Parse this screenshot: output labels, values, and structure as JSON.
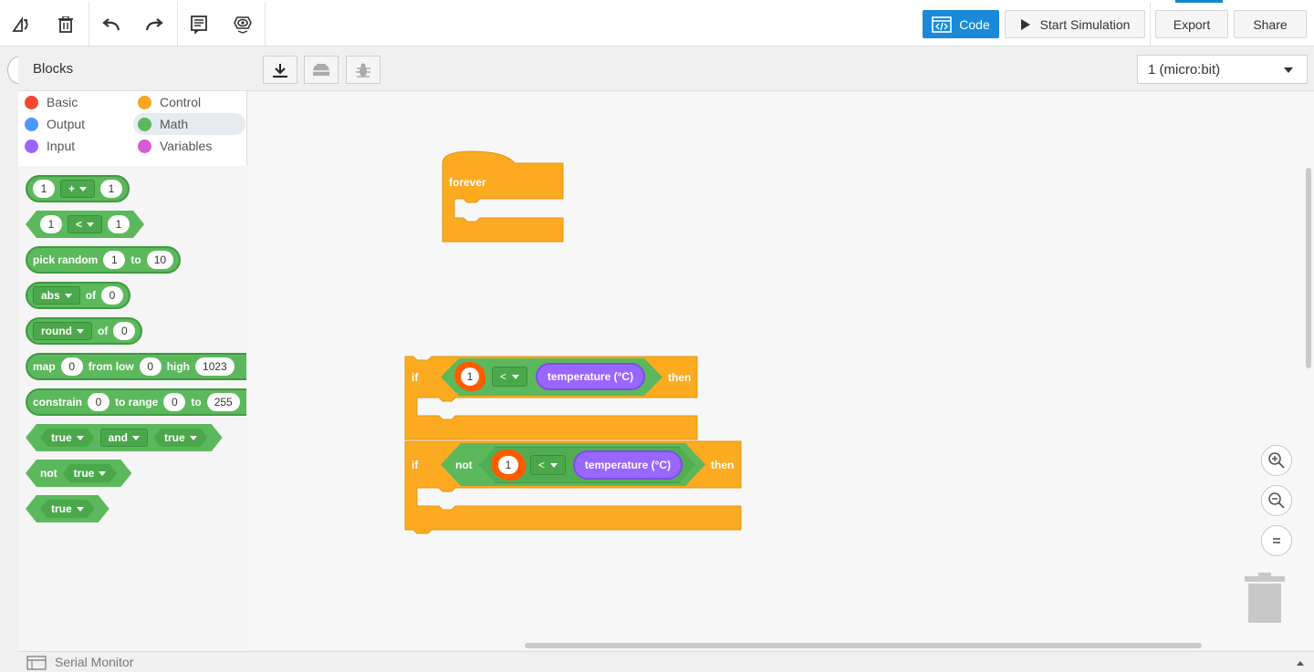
{
  "toolbar": {
    "code_label": "Code",
    "start_sim_label": "Start Simulation",
    "export_label": "Export",
    "share_label": "Share"
  },
  "blocks_panel": {
    "title": "Blocks",
    "categories": [
      {
        "label": "Basic",
        "color": "#f4492e"
      },
      {
        "label": "Control",
        "color": "#f6a51f"
      },
      {
        "label": "Output",
        "color": "#4c97ff"
      },
      {
        "label": "Math",
        "color": "#5cb85c"
      },
      {
        "label": "Input",
        "color": "#9966ff"
      },
      {
        "label": "Variables",
        "color": "#d65cd6"
      }
    ],
    "selected_category": "Math",
    "palette": {
      "add": {
        "a": "1",
        "op": "+",
        "b": "1"
      },
      "compare": {
        "a": "1",
        "op": "<",
        "b": "1"
      },
      "random": {
        "label": "pick random",
        "from": "1",
        "to_label": "to",
        "to": "10"
      },
      "abs": {
        "fn": "abs",
        "of_label": "of",
        "val": "0"
      },
      "round": {
        "fn": "round",
        "of_label": "of",
        "val": "0"
      },
      "map": {
        "label": "map",
        "val": "0",
        "from_low_label": "from low",
        "from_low": "0",
        "high_label": "high",
        "high": "1023"
      },
      "constrain": {
        "label": "constrain",
        "val": "0",
        "to_range_label": "to range",
        "low": "0",
        "to_label": "to",
        "high": "255"
      },
      "and": {
        "a": "true",
        "op": "and",
        "b": "true"
      },
      "not": {
        "label": "not",
        "val": "true"
      },
      "bool": {
        "val": "true"
      }
    }
  },
  "workspace": {
    "board_select": "1 (micro:bit)",
    "forever_label": "forever",
    "if1": {
      "if_label": "if",
      "a": "1",
      "op": "<",
      "sensor": "temperature (°C)",
      "then_label": "then"
    },
    "if2": {
      "if_label": "if",
      "not_label": "not",
      "a": "1",
      "op": "<",
      "sensor": "temperature (°C)",
      "then_label": "then"
    }
  },
  "serial_monitor_label": "Serial Monitor",
  "colors": {
    "control": "#fcaa1f",
    "math": "#5cb85c",
    "input": "#9966ff",
    "accent": "#1a8ad8",
    "highlight": "#ff5b00"
  }
}
